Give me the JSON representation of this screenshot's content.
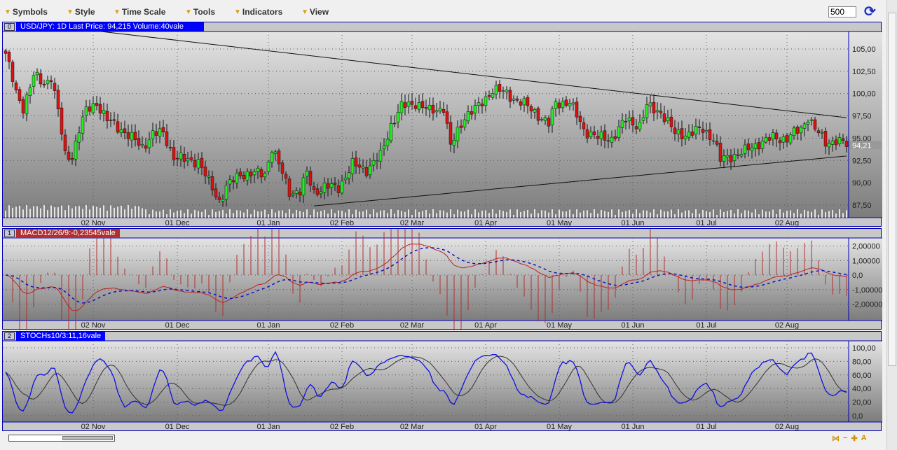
{
  "toolbar": {
    "menus": [
      "Symbols",
      "Style",
      "Time Scale",
      "Tools",
      "Indicators",
      "View"
    ],
    "bars_value": "500"
  },
  "panels": [
    {
      "num": "0",
      "label": "USD/JPY: 1D Last Price: 94,215 Volume:40vale",
      "color": "#0000ff"
    },
    {
      "num": "1",
      "label": "MACD12/26/9:-0,23545vale",
      "color": "#b03030"
    },
    {
      "num": "2",
      "label": "STOCHs10/3:11,16vale",
      "color": "#0000ff"
    }
  ],
  "chart_data": [
    {
      "type": "candlestick",
      "title": "USD/JPY 1D",
      "last_price_label": "94,21",
      "yticks": [
        "105,00",
        "102,50",
        "100,00",
        "97,50",
        "95,00",
        "92,50",
        "90,00",
        "87,50"
      ],
      "ylim": [
        86.8,
        108.5
      ],
      "xticks": [
        "02 Nov",
        "01 Dec",
        "01 Jan",
        "02 Feb",
        "02 Mar",
        "01 Apr",
        "01 May",
        "01 Jun",
        "01 Jul",
        "02 Aug"
      ],
      "xtick_bars": [
        25,
        49,
        75,
        96,
        116,
        137,
        158,
        179,
        200,
        223
      ],
      "bar_count": 241,
      "anchor_closes": [
        [
          0,
          104.5
        ],
        [
          3,
          100
        ],
        [
          5,
          98.5
        ],
        [
          8,
          102
        ],
        [
          11,
          101
        ],
        [
          13,
          102
        ],
        [
          15,
          98
        ],
        [
          17,
          93
        ],
        [
          19,
          93
        ],
        [
          21,
          96
        ],
        [
          23,
          98
        ],
        [
          26,
          99
        ],
        [
          29,
          97
        ],
        [
          33,
          96
        ],
        [
          36,
          95
        ],
        [
          39,
          94
        ],
        [
          42,
          95.5
        ],
        [
          45,
          95.5
        ],
        [
          48,
          93
        ],
        [
          51,
          92.5
        ],
        [
          55,
          92.5
        ],
        [
          58,
          90
        ],
        [
          61,
          88
        ],
        [
          63,
          89.5
        ],
        [
          67,
          91
        ],
        [
          71,
          91
        ],
        [
          74,
          91
        ],
        [
          76,
          94
        ],
        [
          79,
          91
        ],
        [
          81,
          89
        ],
        [
          84,
          89
        ],
        [
          86,
          91
        ],
        [
          88,
          89
        ],
        [
          91,
          89.5
        ],
        [
          95,
          89.5
        ],
        [
          99,
          92
        ],
        [
          103,
          91.5
        ],
        [
          107,
          93
        ],
        [
          110,
          96.5
        ],
        [
          113,
          98.5
        ],
        [
          117,
          99
        ],
        [
          121,
          98
        ],
        [
          125,
          98.5
        ],
        [
          127,
          94
        ],
        [
          131,
          97.5
        ],
        [
          135,
          98.5
        ],
        [
          139,
          100.5
        ],
        [
          143,
          100
        ],
        [
          147,
          99
        ],
        [
          151,
          98
        ],
        [
          155,
          96.5
        ],
        [
          157,
          99
        ],
        [
          161,
          99
        ],
        [
          165,
          96
        ],
        [
          169,
          95
        ],
        [
          173,
          95
        ],
        [
          177,
          97
        ],
        [
          181,
          96.5
        ],
        [
          183,
          98.5
        ],
        [
          187,
          98
        ],
        [
          191,
          95.5
        ],
        [
          195,
          95.5
        ],
        [
          199,
          96
        ],
        [
          202,
          95
        ],
        [
          204,
          92.5
        ],
        [
          207,
          93
        ],
        [
          211,
          93.5
        ],
        [
          215,
          94.5
        ],
        [
          219,
          95
        ],
        [
          223,
          95
        ],
        [
          227,
          96
        ],
        [
          229,
          97.5
        ],
        [
          231,
          96
        ],
        [
          234,
          94.5
        ],
        [
          237,
          94.8
        ],
        [
          240,
          94.2
        ]
      ],
      "trendlines": [
        {
          "from": [
            0,
            108.2
          ],
          "to": [
            240,
            97.3
          ]
        },
        {
          "from": [
            88,
            87.4
          ],
          "to": [
            240,
            93
          ]
        }
      ]
    },
    {
      "type": "macd",
      "yticks": [
        "2,00000",
        "1,00000",
        "0,0",
        "-1,00000",
        "-2,00000"
      ],
      "ylim": [
        -3,
        3
      ],
      "params": [
        12,
        26,
        9
      ],
      "last": "-0,23545"
    },
    {
      "type": "stochastic",
      "yticks": [
        "100,00",
        "80,00",
        "60,00",
        "40,00",
        "20,00",
        "0,0"
      ],
      "ylim": [
        -5,
        105
      ],
      "params": [
        10,
        3
      ],
      "last": "11,16"
    }
  ]
}
